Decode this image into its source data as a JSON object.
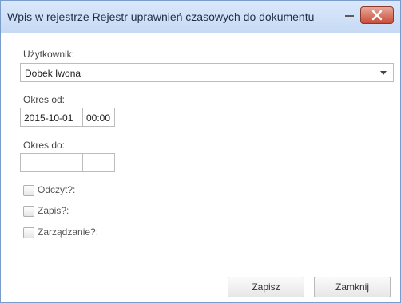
{
  "window": {
    "title": "Wpis w rejestrze Rejestr uprawnień czasowych do dokumentu"
  },
  "form": {
    "user": {
      "label": "Użytkownik:",
      "value": "Dobek Iwona"
    },
    "from": {
      "label": "Okres od:",
      "date": "2015-10-01",
      "time": "00:00"
    },
    "to": {
      "label": "Okres do:",
      "date": "",
      "time": ""
    },
    "checkboxes": [
      {
        "label": "Odczyt?:",
        "checked": false
      },
      {
        "label": "Zapis?:",
        "checked": false
      },
      {
        "label": "Zarządzanie?:",
        "checked": false
      }
    ]
  },
  "buttons": {
    "save": "Zapisz",
    "close": "Zamknij"
  },
  "colors": {
    "titlebar": "#c6daf5",
    "close_button": "#c94d38",
    "border": "#7a9ccc"
  },
  "icons": {
    "minimize": "minimize-icon",
    "close": "close-icon",
    "dropdown": "chevron-down-icon"
  }
}
